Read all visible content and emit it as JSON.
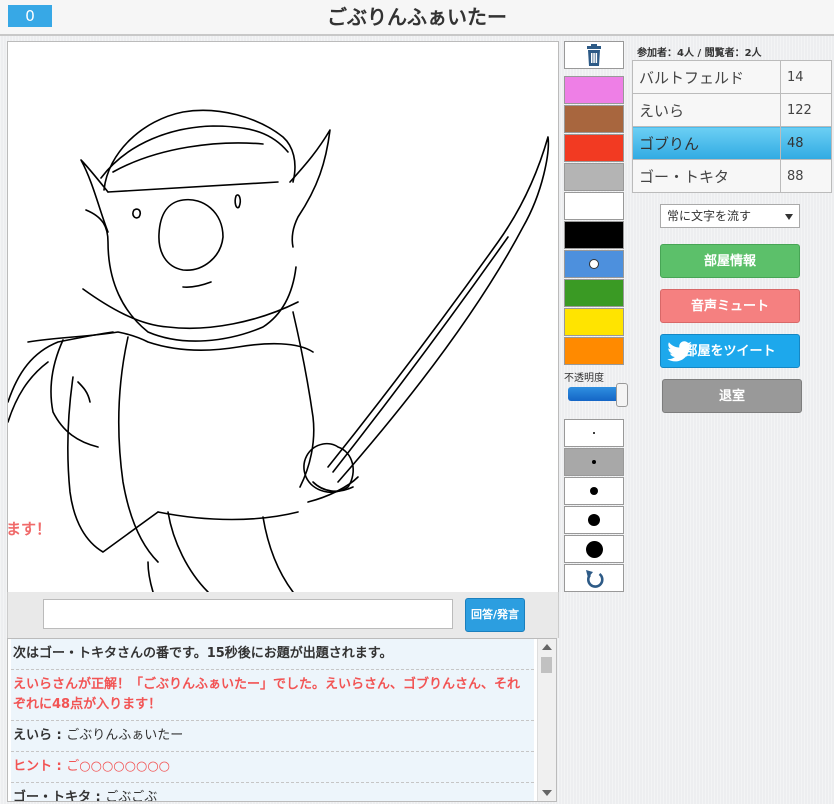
{
  "header": {
    "counter": "0",
    "title": "ごぶりんふぁいたー"
  },
  "canvas": {
    "marquee_text": "ます！"
  },
  "answer": {
    "placeholder": "",
    "button_label": "回答/発言"
  },
  "chat": {
    "lines": [
      {
        "text": "次はゴー・トキタさんの番です。15秒後にお題が出題されます。"
      },
      {
        "text": "えいらさんが正解！「ごぶりんふぁいたー」でした。えいらさん、ゴブりんさん、それぞれに48点が入ります！"
      },
      {
        "name": "えいら",
        "message": "ごぶりんふぁいたー"
      },
      {
        "name": "ヒント",
        "message": "ご○○○○○○○○"
      },
      {
        "name": "ゴー・トキタ",
        "message": "ごぶごぶ"
      }
    ]
  },
  "tools": {
    "colors": [
      {
        "name": "pink",
        "hex": "#ee7fe6"
      },
      {
        "name": "brown",
        "hex": "#a8663e"
      },
      {
        "name": "red",
        "hex": "#f23a22"
      },
      {
        "name": "gray",
        "hex": "#b4b4b4"
      },
      {
        "name": "white",
        "hex": "#ffffff"
      },
      {
        "name": "black",
        "hex": "#000000"
      },
      {
        "name": "blue",
        "hex": "#4d90dd"
      },
      {
        "name": "green",
        "hex": "#3a9a24"
      },
      {
        "name": "yellow",
        "hex": "#ffe400"
      },
      {
        "name": "orange",
        "hex": "#ff8a00"
      }
    ],
    "selected_color": "blue",
    "opacity_label": "不透明度",
    "opacity_value": 1.0,
    "brush_sizes": [
      "xs",
      "s",
      "m",
      "l",
      "xl"
    ],
    "selected_brush": "s",
    "icons": {
      "clear": "trash-icon",
      "undo": "undo-icon"
    }
  },
  "room": {
    "info": "参加者：4人 / 閲覧者：2人",
    "players": [
      {
        "name": "バルトフェルド",
        "score": "14",
        "active": false
      },
      {
        "name": "えいら",
        "score": "122",
        "active": false
      },
      {
        "name": "ゴブりん",
        "score": "48",
        "active": true
      },
      {
        "name": "ゴー・トキタ",
        "score": "88",
        "active": false
      }
    ],
    "text_mode": "常に文字を流す",
    "buttons": {
      "room_info": "部屋情報",
      "mute": "音声ミュート",
      "tweet": "部屋をツイート",
      "leave": "退室"
    },
    "colors": {
      "accent": "#30aae2",
      "room_info": "#5cc06a",
      "mute": "#f58080",
      "tweet": "#1da8ec",
      "leave": "#999999"
    }
  }
}
